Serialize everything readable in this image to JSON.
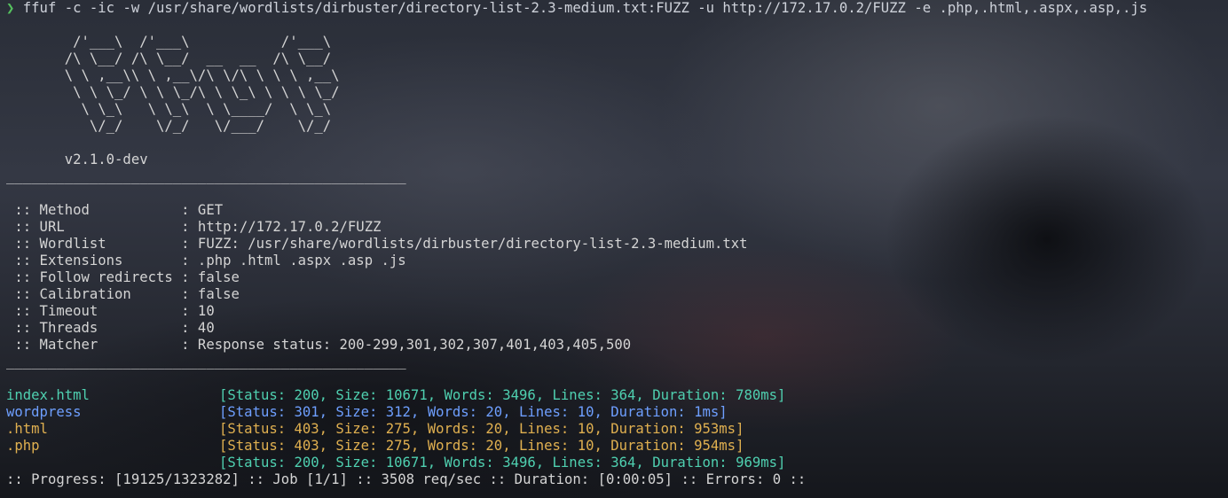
{
  "terminal": {
    "prompt_symbol": "❯",
    "command": "ffuf -c -ic -w /usr/share/wordlists/dirbuster/directory-list-2.3-medium.txt:FUZZ -u http://172.17.0.2/FUZZ -e .php,.html,.aspx,.asp,.js",
    "banner_lines": [
      "        /'___\\  /'___\\           /'___\\       ",
      "       /\\ \\__/ /\\ \\__/  __  __  /\\ \\__/       ",
      "       \\ \\ ,__\\\\ \\ ,__\\/\\ \\/\\ \\ \\ \\ ,__\\      ",
      "        \\ \\ \\_/ \\ \\ \\_/\\ \\ \\_\\ \\ \\ \\ \\_/      ",
      "         \\ \\_\\   \\ \\_\\  \\ \\____/  \\ \\_\\       ",
      "          \\/_/    \\/_/   \\/___/    \\/_/       "
    ],
    "version": "       v2.1.0-dev",
    "separator": "________________________________________________",
    "config": [
      {
        "key": " :: Method           ",
        "value": ": GET"
      },
      {
        "key": " :: URL              ",
        "value": ": http://172.17.0.2/FUZZ"
      },
      {
        "key": " :: Wordlist         ",
        "value": ": FUZZ: /usr/share/wordlists/dirbuster/directory-list-2.3-medium.txt"
      },
      {
        "key": " :: Extensions       ",
        "value": ": .php .html .aspx .asp .js"
      },
      {
        "key": " :: Follow redirects ",
        "value": ": false"
      },
      {
        "key": " :: Calibration      ",
        "value": ": false"
      },
      {
        "key": " :: Timeout          ",
        "value": ": 10"
      },
      {
        "key": " :: Threads          ",
        "value": ": 40"
      },
      {
        "key": " :: Matcher          ",
        "value": ": Response status: 200-299,301,302,307,401,403,405,500"
      }
    ],
    "results": [
      {
        "name": "index.html",
        "info": "[Status: 200, Size: 10671, Words: 3496, Lines: 364, Duration: 780ms]",
        "color": "#4fd0b0"
      },
      {
        "name": "wordpress",
        "info": "[Status: 301, Size: 312, Words: 20, Lines: 10, Duration: 1ms]",
        "color": "#6e9fff"
      },
      {
        "name": ".html",
        "info": "[Status: 403, Size: 275, Words: 20, Lines: 10, Duration: 953ms]",
        "color": "#e0b050"
      },
      {
        "name": ".php",
        "info": "[Status: 403, Size: 275, Words: 20, Lines: 10, Duration: 954ms]",
        "color": "#e0b050"
      },
      {
        "name": "",
        "info": "[Status: 200, Size: 10671, Words: 3496, Lines: 364, Duration: 969ms]",
        "color": "#4fd0b0"
      }
    ],
    "progress": ":: Progress: [19125/1323282] :: Job [1/1] :: 3508 req/sec :: Duration: [0:00:05] :: Errors: 0 ::"
  }
}
